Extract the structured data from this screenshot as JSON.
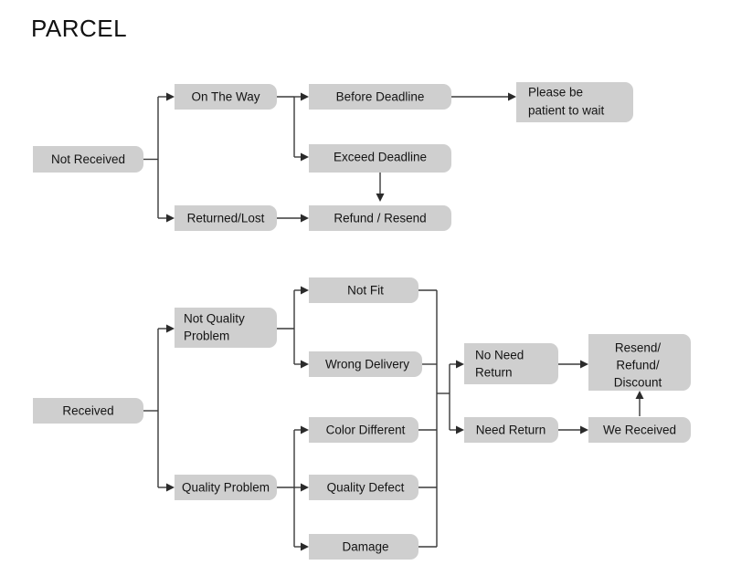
{
  "title": "PARCEL",
  "colors": {
    "background": "#ffffff",
    "node_fill": "#cfcfcf",
    "node_text": "#141414",
    "connector": "#3a3a3a",
    "title_text": "#111111"
  },
  "chart_data": {
    "type": "diagram",
    "title": "PARCEL",
    "diagram_kind": "flowchart-tree",
    "orientation": "left-to-right",
    "node_style": "rounded-gray-box",
    "branches": [
      {
        "name": "not-received-branch",
        "root": "Not Received",
        "paths": [
          [
            "Not Received",
            "On The Way",
            "Before Deadline",
            "Please be patient to wait"
          ],
          [
            "Not Received",
            "On The Way",
            "Exceed Deadline",
            "Refund / Resend"
          ],
          [
            "Not Received",
            "Returned/Lost",
            "Refund / Resend"
          ]
        ]
      },
      {
        "name": "received-branch",
        "root": "Received",
        "paths": [
          [
            "Received",
            "Not Quality Problem",
            "Not Fit",
            "No Need Return",
            "Resend/ Refund/ Discount"
          ],
          [
            "Received",
            "Not Quality Problem",
            "Wrong Delivery",
            "No Need Return",
            "Resend/ Refund/ Discount"
          ],
          [
            "Received",
            "Quality Problem",
            "Color Different",
            "Need Return",
            "We Received",
            "Resend/ Refund/ Discount"
          ],
          [
            "Received",
            "Quality Problem",
            "Quality Defect",
            "Need Return",
            "We Received",
            "Resend/ Refund/ Discount"
          ],
          [
            "Received",
            "Quality Problem",
            "Damage",
            "Need Return",
            "We Received",
            "Resend/ Refund/ Discount"
          ]
        ]
      }
    ]
  },
  "nodes": {
    "not_received": {
      "label": "Not Received"
    },
    "on_the_way": {
      "label": "On The Way"
    },
    "returned_lost": {
      "label": "Returned/Lost"
    },
    "before_deadline": {
      "label": "Before Deadline"
    },
    "exceed_deadline": {
      "label": "Exceed Deadline"
    },
    "refund_resend": {
      "label": "Refund / Resend"
    },
    "please_wait": {
      "line1": "Please be",
      "line2": "patient to wait"
    },
    "received": {
      "label": "Received"
    },
    "not_quality": {
      "line1": "Not Quality",
      "line2": "Problem"
    },
    "quality_problem": {
      "label": "Quality Problem"
    },
    "not_fit": {
      "label": "Not Fit"
    },
    "wrong_delivery": {
      "label": "Wrong Delivery"
    },
    "color_different": {
      "label": "Color Different"
    },
    "quality_defect": {
      "label": "Quality Defect"
    },
    "damage": {
      "label": "Damage"
    },
    "no_need_return": {
      "line1": "No Need",
      "line2": "Return"
    },
    "need_return": {
      "label": "Need Return"
    },
    "we_received": {
      "label": "We Received"
    },
    "resend_refund": {
      "line1": "Resend/",
      "line2": "Refund/",
      "line3": "Discount"
    }
  }
}
